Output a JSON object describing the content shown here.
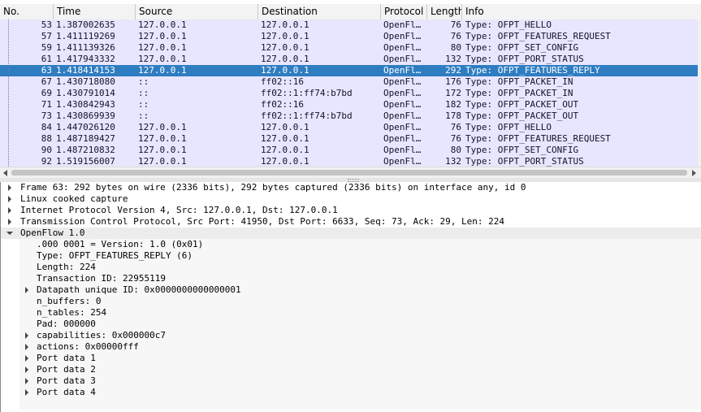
{
  "columns": {
    "no": "No.",
    "time": "Time",
    "source": "Source",
    "destination": "Destination",
    "protocol": "Protocol",
    "length": "Length",
    "info": "Info"
  },
  "packets": [
    {
      "no": "53",
      "time": "1.387002635",
      "src": "127.0.0.1",
      "dst": "127.0.0.1",
      "proto": "OpenFl…",
      "len": "76",
      "info": "Type: OFPT_HELLO"
    },
    {
      "no": "57",
      "time": "1.411119269",
      "src": "127.0.0.1",
      "dst": "127.0.0.1",
      "proto": "OpenFl…",
      "len": "76",
      "info": "Type: OFPT_FEATURES_REQUEST"
    },
    {
      "no": "59",
      "time": "1.411139326",
      "src": "127.0.0.1",
      "dst": "127.0.0.1",
      "proto": "OpenFl…",
      "len": "80",
      "info": "Type: OFPT_SET_CONFIG"
    },
    {
      "no": "61",
      "time": "1.417943332",
      "src": "127.0.0.1",
      "dst": "127.0.0.1",
      "proto": "OpenFl…",
      "len": "132",
      "info": "Type: OFPT_PORT_STATUS"
    },
    {
      "no": "63",
      "time": "1.418414153",
      "src": "127.0.0.1",
      "dst": "127.0.0.1",
      "proto": "OpenFl…",
      "len": "292",
      "info": "Type: OFPT_FEATURES_REPLY",
      "selected": true
    },
    {
      "no": "67",
      "time": "1.430718080",
      "src": "::",
      "dst": "ff02::16",
      "proto": "OpenFl…",
      "len": "176",
      "info": "Type: OFPT_PACKET_IN"
    },
    {
      "no": "69",
      "time": "1.430791014",
      "src": "::",
      "dst": "ff02::1:ff74:b7bd",
      "proto": "OpenFl…",
      "len": "172",
      "info": "Type: OFPT_PACKET_IN"
    },
    {
      "no": "71",
      "time": "1.430842943",
      "src": "::",
      "dst": "ff02::16",
      "proto": "OpenFl…",
      "len": "182",
      "info": "Type: OFPT_PACKET_OUT"
    },
    {
      "no": "73",
      "time": "1.430869939",
      "src": "::",
      "dst": "ff02::1:ff74:b7bd",
      "proto": "OpenFl…",
      "len": "178",
      "info": "Type: OFPT_PACKET_OUT"
    },
    {
      "no": "84",
      "time": "1.447026120",
      "src": "127.0.0.1",
      "dst": "127.0.0.1",
      "proto": "OpenFl…",
      "len": "76",
      "info": "Type: OFPT_HELLO"
    },
    {
      "no": "88",
      "time": "1.487189427",
      "src": "127.0.0.1",
      "dst": "127.0.0.1",
      "proto": "OpenFl…",
      "len": "76",
      "info": "Type: OFPT_FEATURES_REQUEST"
    },
    {
      "no": "90",
      "time": "1.487210832",
      "src": "127.0.0.1",
      "dst": "127.0.0.1",
      "proto": "OpenFl…",
      "len": "80",
      "info": "Type: OFPT_SET_CONFIG"
    },
    {
      "no": "92",
      "time": "1.519156007",
      "src": "127.0.0.1",
      "dst": "127.0.0.1",
      "proto": "OpenFl…",
      "len": "132",
      "info": "Type: OFPT_PORT_STATUS"
    }
  ],
  "details": [
    {
      "text": "Frame 63: 292 bytes on wire (2336 bits), 292 bytes captured (2336 bits) on interface any, id 0",
      "level": 0,
      "state": "closed"
    },
    {
      "text": "Linux cooked capture",
      "level": 0,
      "state": "closed"
    },
    {
      "text": "Internet Protocol Version 4, Src: 127.0.0.1, Dst: 127.0.0.1",
      "level": 0,
      "state": "closed"
    },
    {
      "text": "Transmission Control Protocol, Src Port: 41950, Dst Port: 6633, Seq: 73, Ack: 29, Len: 224",
      "level": 0,
      "state": "closed"
    },
    {
      "text": "OpenFlow 1.0",
      "level": 0,
      "state": "open"
    },
    {
      "text": ".000 0001 = Version: 1.0 (0x01)",
      "level": 1,
      "state": "leaf"
    },
    {
      "text": "Type: OFPT_FEATURES_REPLY (6)",
      "level": 1,
      "state": "leaf"
    },
    {
      "text": "Length: 224",
      "level": 1,
      "state": "leaf"
    },
    {
      "text": "Transaction ID: 22955119",
      "level": 1,
      "state": "leaf"
    },
    {
      "text": "Datapath unique ID: 0x0000000000000001",
      "level": 1,
      "state": "closed"
    },
    {
      "text": "n_buffers: 0",
      "level": 1,
      "state": "leaf"
    },
    {
      "text": "n_tables: 254",
      "level": 1,
      "state": "leaf"
    },
    {
      "text": "Pad: 000000",
      "level": 1,
      "state": "leaf"
    },
    {
      "text": "capabilities: 0x000000c7",
      "level": 1,
      "state": "closed"
    },
    {
      "text": "actions: 0x00000fff",
      "level": 1,
      "state": "closed"
    },
    {
      "text": "Port data 1",
      "level": 1,
      "state": "closed"
    },
    {
      "text": "Port data 2",
      "level": 1,
      "state": "closed"
    },
    {
      "text": "Port data 3",
      "level": 1,
      "state": "closed"
    },
    {
      "text": "Port data 4",
      "level": 1,
      "state": "closed"
    }
  ]
}
